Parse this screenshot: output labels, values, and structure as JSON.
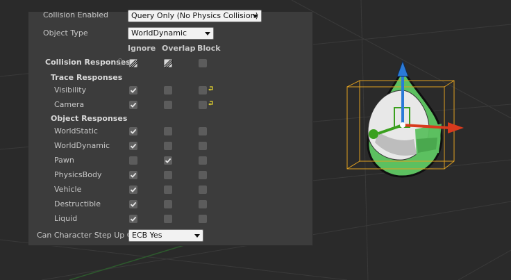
{
  "collision_enabled": {
    "label": "Collision Enabled",
    "value": "Query Only (No Physics Collision)"
  },
  "object_type": {
    "label": "Object Type",
    "value": "WorldDynamic"
  },
  "columns": [
    "Ignore",
    "Overlap",
    "Block"
  ],
  "collision_responses_label": "Collision Responses",
  "trace_responses_label": "Trace Responses",
  "object_responses_label": "Object Responses",
  "trace_rows": [
    {
      "label": "Visibility",
      "state": "ignore"
    },
    {
      "label": "Camera",
      "state": "ignore"
    }
  ],
  "object_rows": [
    {
      "label": "WorldStatic",
      "state": "ignore"
    },
    {
      "label": "WorldDynamic",
      "state": "ignore"
    },
    {
      "label": "Pawn",
      "state": "overlap"
    },
    {
      "label": "PhysicsBody",
      "state": "ignore"
    },
    {
      "label": "Vehicle",
      "state": "ignore"
    },
    {
      "label": "Destructible",
      "state": "ignore"
    },
    {
      "label": "Liquid",
      "state": "ignore"
    }
  ],
  "step_up": {
    "label": "Can Character Step Up O",
    "value": "ECB Yes"
  },
  "colors": {
    "panel_bg": "#3c3c3c",
    "viewport_bg": "#2a2a2a",
    "bounds_box": "#e0a020",
    "gizmo_z": "#2a7ad8",
    "gizmo_x": "#d83a1e",
    "gizmo_y": "#3aa01e",
    "mesh_green": "#5cc060",
    "reset_arrow": "#e8d830"
  }
}
